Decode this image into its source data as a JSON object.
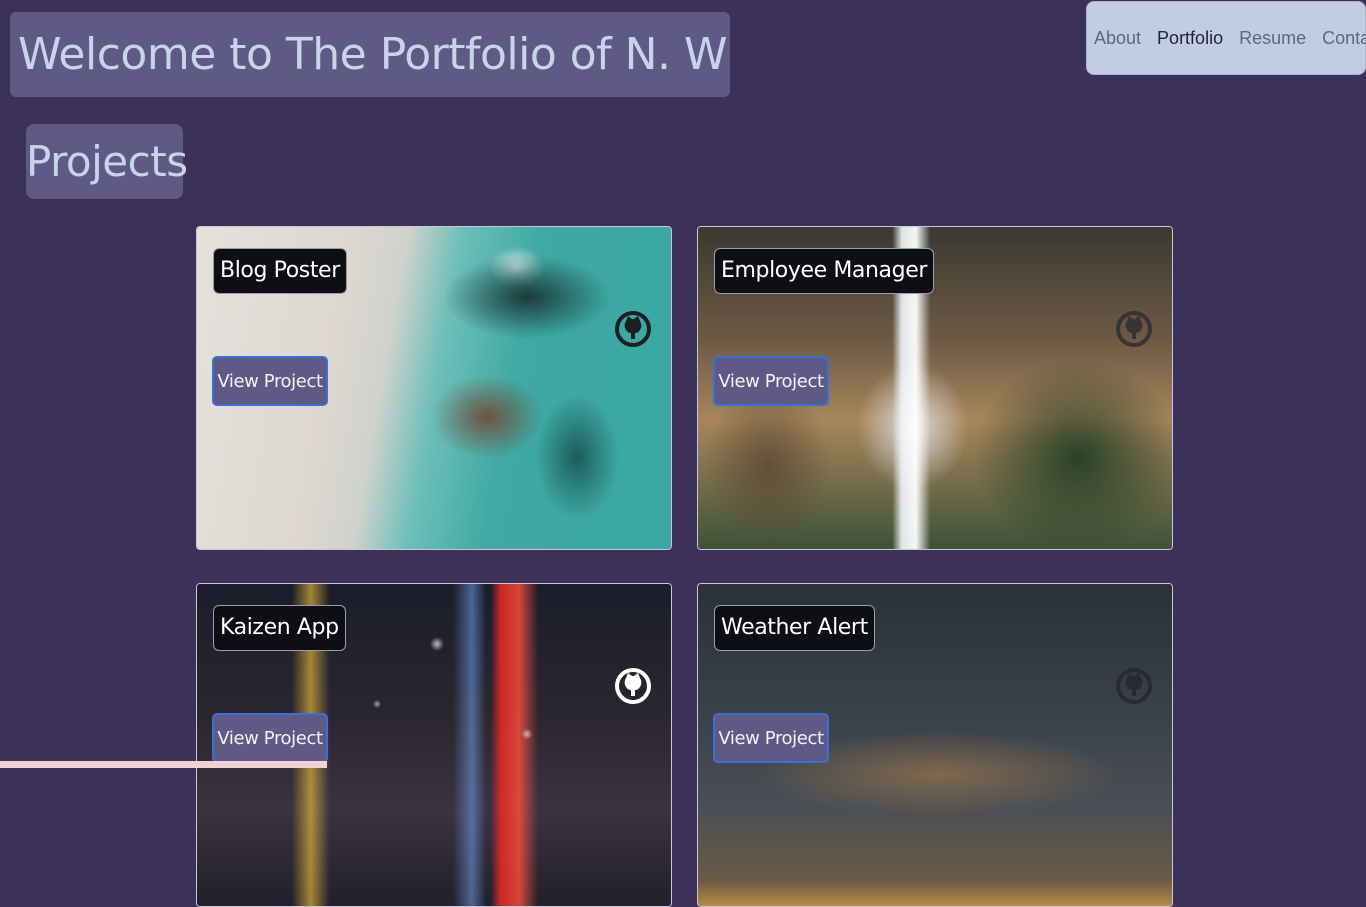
{
  "header": {
    "title": "Welcome to The Portfolio of N. Wilson"
  },
  "nav": {
    "items": [
      {
        "label": "About",
        "active": false
      },
      {
        "label": "Portfolio",
        "active": true
      },
      {
        "label": "Resume",
        "active": false
      },
      {
        "label": "Contact",
        "active": false
      }
    ]
  },
  "projects": {
    "heading": "Projects",
    "button_label": "View Project",
    "cards": [
      {
        "title": "Blog Poster",
        "background": "beach-aerial",
        "icon": "github-icon"
      },
      {
        "title": "Employee Manager",
        "background": "waterfall-canyon",
        "icon": "github-icon"
      },
      {
        "title": "Kaizen App",
        "background": "city-night-neon",
        "icon": "github-icon"
      },
      {
        "title": "Weather Alert",
        "background": "cloudy-sunset",
        "icon": "github-icon"
      }
    ]
  },
  "colors": {
    "page_background": "#3c3259",
    "panel_background": "#5e5a85",
    "heading_text": "#c9d3ea",
    "nav_background": "#c2cde4",
    "button_border": "#3b6fd6"
  }
}
